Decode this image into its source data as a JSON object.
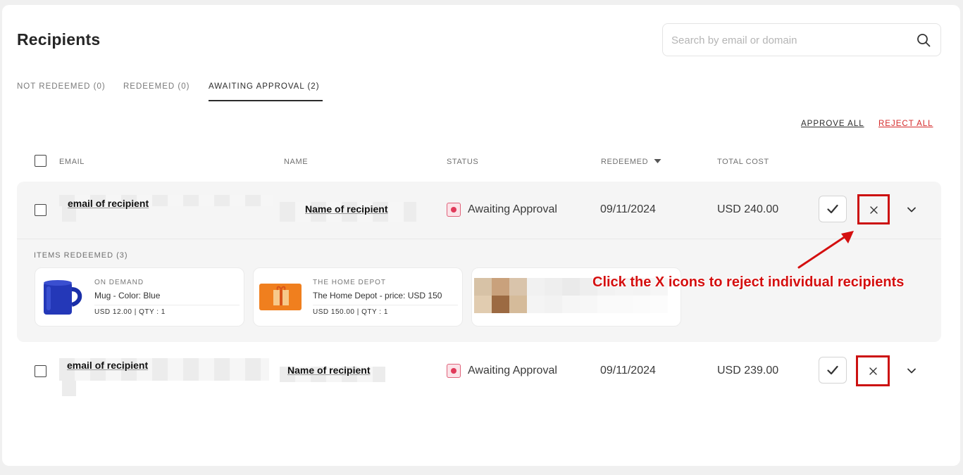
{
  "page": {
    "title": "Recipients"
  },
  "search": {
    "placeholder": "Search by email or domain",
    "icon": "search-icon"
  },
  "tabs": [
    {
      "label": "NOT REDEEMED (0)",
      "active": false
    },
    {
      "label": "REDEEMED (0)",
      "active": false
    },
    {
      "label": "AWAITING APPROVAL (2)",
      "active": true
    }
  ],
  "bulk_actions": {
    "approve_all": "APPROVE ALL",
    "reject_all": "REJECT ALL",
    "reject_color": "#d52b2b"
  },
  "table": {
    "headers": {
      "email": "EMAIL",
      "name": "NAME",
      "status": "STATUS",
      "redeemed": "REDEEMED",
      "total_cost": "TOTAL COST"
    },
    "sort_icon": "caret-down-icon",
    "rows": [
      {
        "email": "email of recipient",
        "name": "Name of recipient",
        "status": "Awaiting Approval",
        "redeemed": "09/11/2024",
        "total_cost": "USD 240.00",
        "expanded": true,
        "items_title": "ITEMS REDEEMED (3)",
        "items": [
          {
            "vendor": "ON DEMAND",
            "name": "Mug - Color: Blue",
            "price": "USD 12.00",
            "qty": "QTY : 1"
          },
          {
            "vendor": "THE HOME DEPOT",
            "name": "The Home Depot - price: USD 150",
            "price": "USD 150.00",
            "qty": "QTY : 1"
          }
        ]
      },
      {
        "email": "email of recipient",
        "name": "Name of recipient",
        "status": "Awaiting Approval",
        "redeemed": "09/11/2024",
        "total_cost": "USD 239.00",
        "expanded": false
      }
    ]
  },
  "annotation": {
    "text": "Click the X icons to reject individual recipients",
    "color": "#d40f0f"
  },
  "colors": {
    "status_dot": "#e03a5a",
    "highlight": "#cc1111"
  }
}
